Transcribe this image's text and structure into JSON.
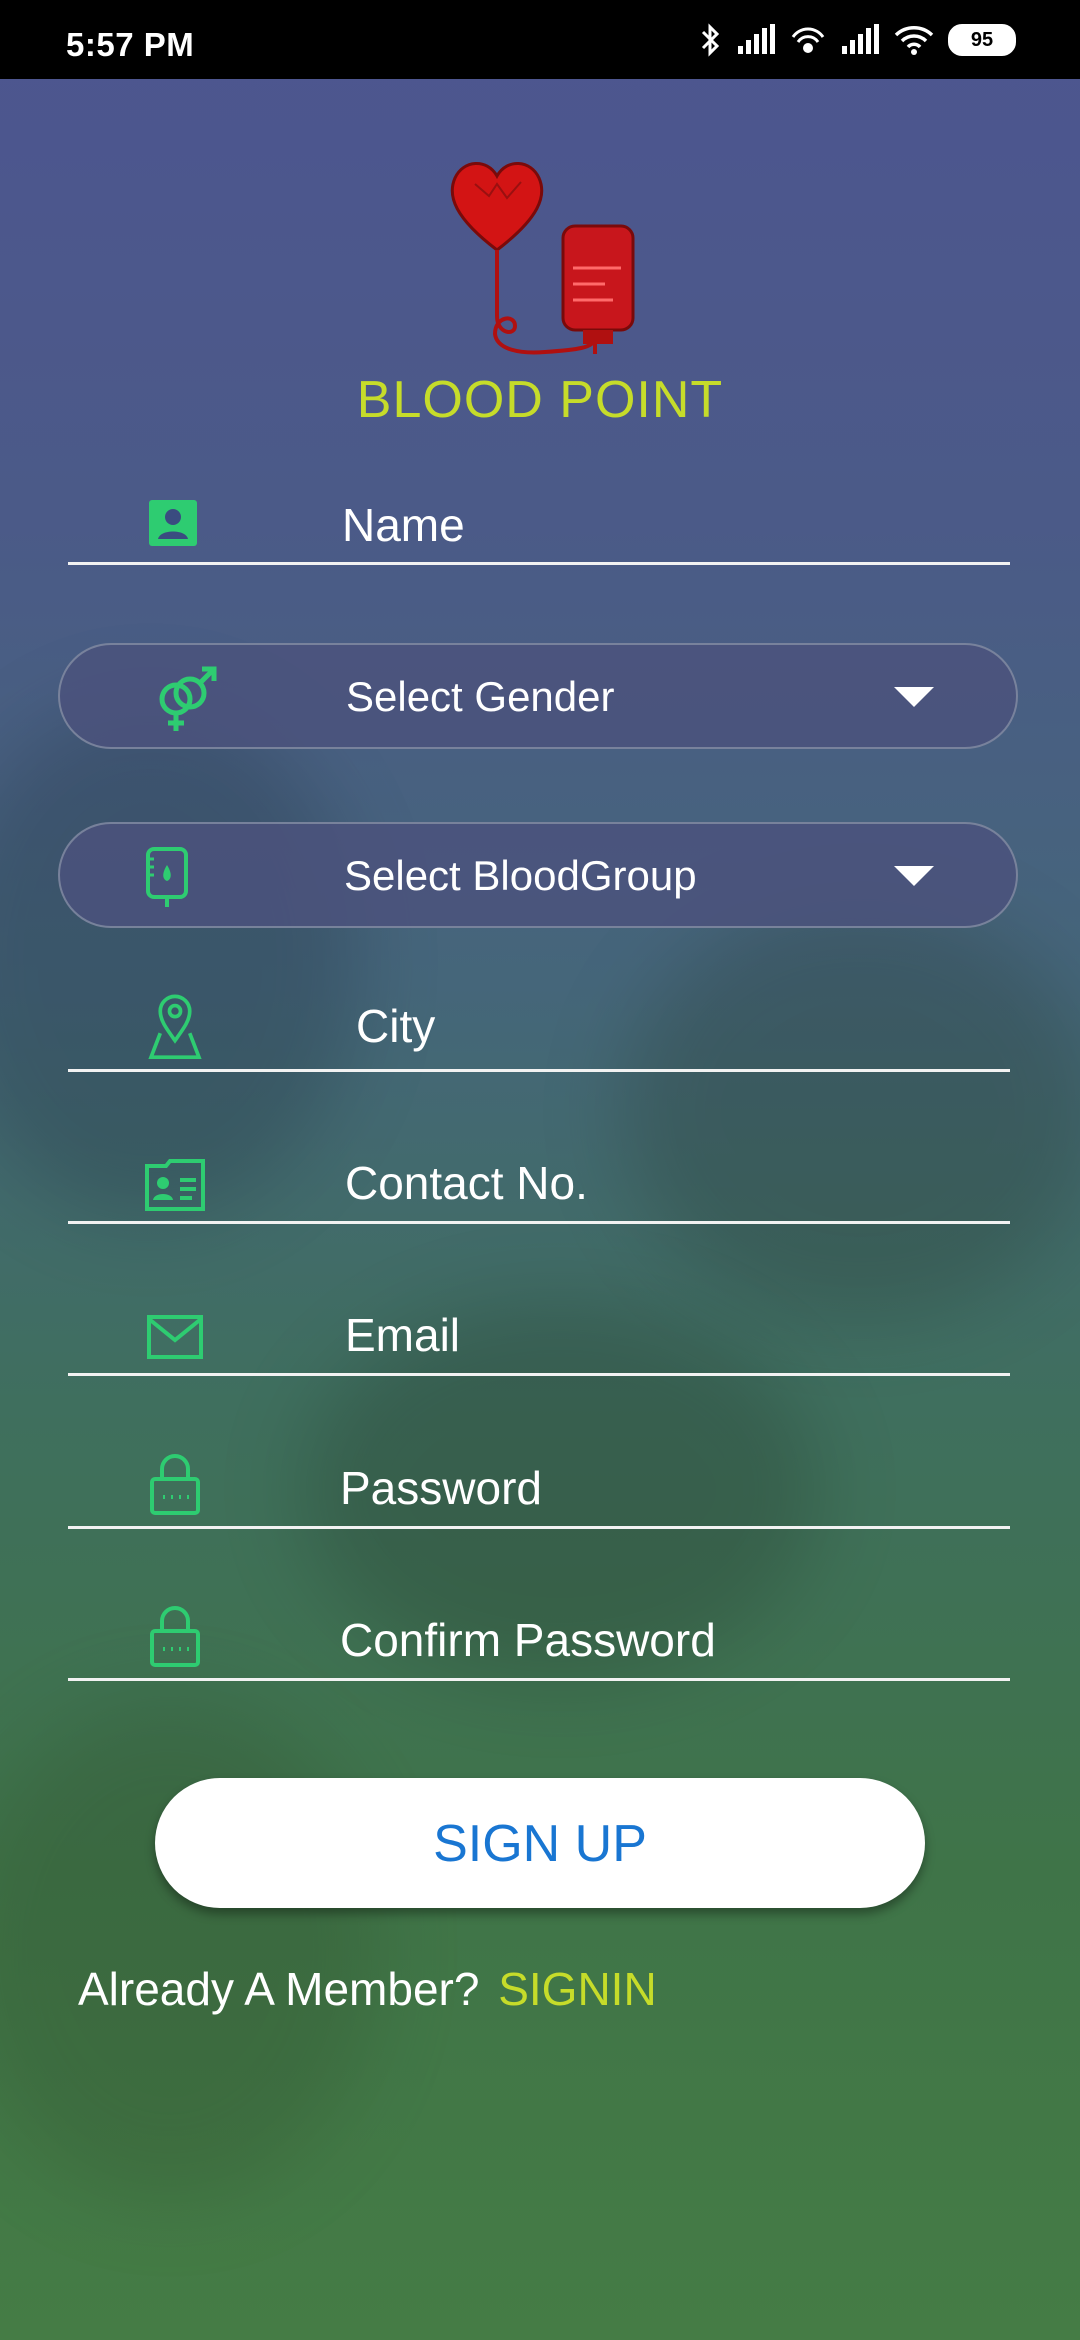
{
  "status_bar": {
    "time": "5:57 PM",
    "battery": "95",
    "icons": [
      "bluetooth-icon",
      "signal-icon",
      "hotspot-icon",
      "signal-icon",
      "wifi-icon",
      "battery-icon"
    ]
  },
  "app": {
    "title": "BLOOD POINT",
    "accent_color": "#c6dc2a",
    "icon_color": "#2ecc71",
    "button_text_color": "#1976d2"
  },
  "form": {
    "name_placeholder": "Name",
    "gender_select": "Select Gender",
    "bloodgroup_select": "Select BloodGroup",
    "city_placeholder": "City",
    "contact_placeholder": "Contact No.",
    "email_placeholder": "Email",
    "password_placeholder": "Password",
    "confirm_password_placeholder": "Confirm Password"
  },
  "actions": {
    "signup_label": "SIGN UP",
    "member_text": "Already A Member?",
    "signin_label": "SIGNIN"
  }
}
